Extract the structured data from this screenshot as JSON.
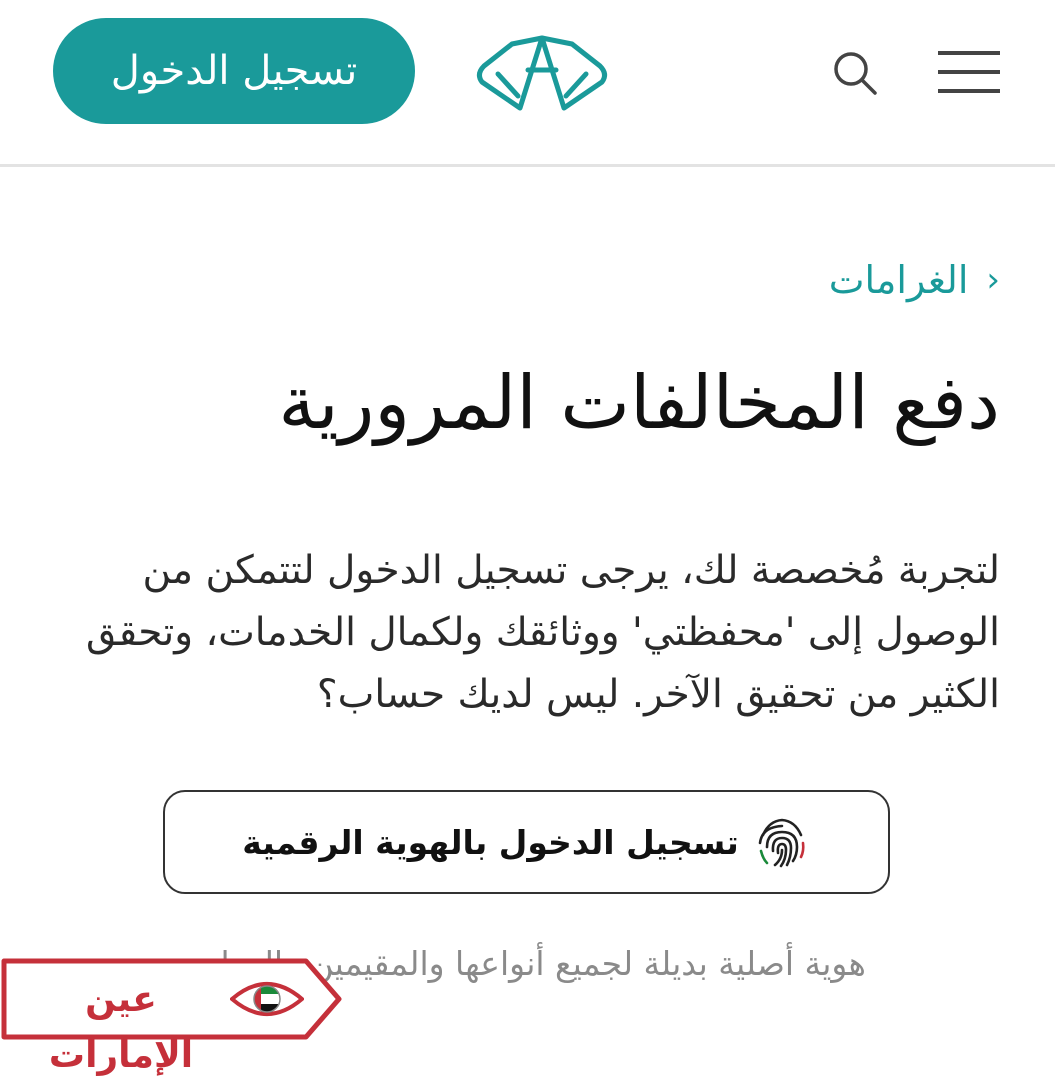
{
  "header": {
    "login_label": "تسجيل الدخول",
    "logo_icon": "tamm-logo-icon",
    "search_icon": "search-icon",
    "menu_icon": "hamburger-menu-icon"
  },
  "breadcrumb": {
    "chevron": "‹",
    "label": "الغرامات"
  },
  "main": {
    "title": "دفع المخالفات المرورية",
    "intro": "لتجربة مُخصصة لك، يرجى تسجيل الدخول لتتمكن من الوصول إلى 'محفظتي' ووثائقك ولكمال الخدمات، وتحقق الكثير من تحقيق الآخر. ليس لديك حساب؟",
    "uaepass_label": "تسجيل الدخول بالهوية الرقمية",
    "uaepass_icon": "fingerprint-icon",
    "note": "هوية أصلية بديلة لجميع أنواعها والمقيمين والزوار."
  },
  "watermark": {
    "text": "عين الإمارات",
    "icon": "eye-flag-icon"
  },
  "colors": {
    "accent": "#1a9a9a",
    "title": "#111111",
    "body": "#2a2a2a",
    "muted": "#8a8a8a",
    "watermark": "#c5303a"
  }
}
